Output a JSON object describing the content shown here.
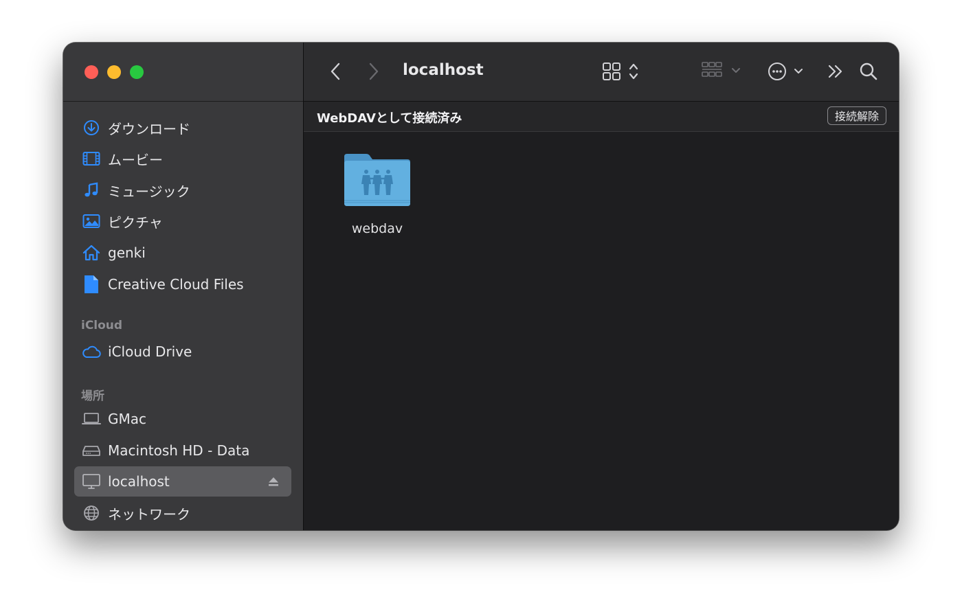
{
  "window": {
    "title": "localhost"
  },
  "sidebar": {
    "favorites": [
      {
        "label": "ダウンロード",
        "icon": "download-icon"
      },
      {
        "label": "ムービー",
        "icon": "film-icon"
      },
      {
        "label": "ミュージック",
        "icon": "music-note-icon"
      },
      {
        "label": "ピクチャ",
        "icon": "photo-icon"
      },
      {
        "label": "genki",
        "icon": "home-icon"
      },
      {
        "label": "Creative Cloud Files",
        "icon": "document-icon"
      }
    ],
    "icloud_header": "iCloud",
    "icloud": [
      {
        "label": "iCloud Drive",
        "icon": "cloud-icon"
      }
    ],
    "locations_header": "場所",
    "locations": [
      {
        "label": "GMac",
        "icon": "laptop-icon"
      },
      {
        "label": "Macintosh HD - Data",
        "icon": "disk-icon"
      },
      {
        "label": "localhost",
        "icon": "display-icon",
        "selected": true
      },
      {
        "label": "ネットワーク",
        "icon": "globe-icon"
      }
    ]
  },
  "infobar": {
    "status": "WebDAVとして接続済み",
    "disconnect_label": "接続解除"
  },
  "files": [
    {
      "name": "webdav",
      "icon": "shared-folder-icon"
    }
  ],
  "colors": {
    "accent": "#2f8cff",
    "folder": "#5aa6d6",
    "close": "#ff5f57",
    "minimize": "#febc2e",
    "maximize": "#28c840"
  }
}
